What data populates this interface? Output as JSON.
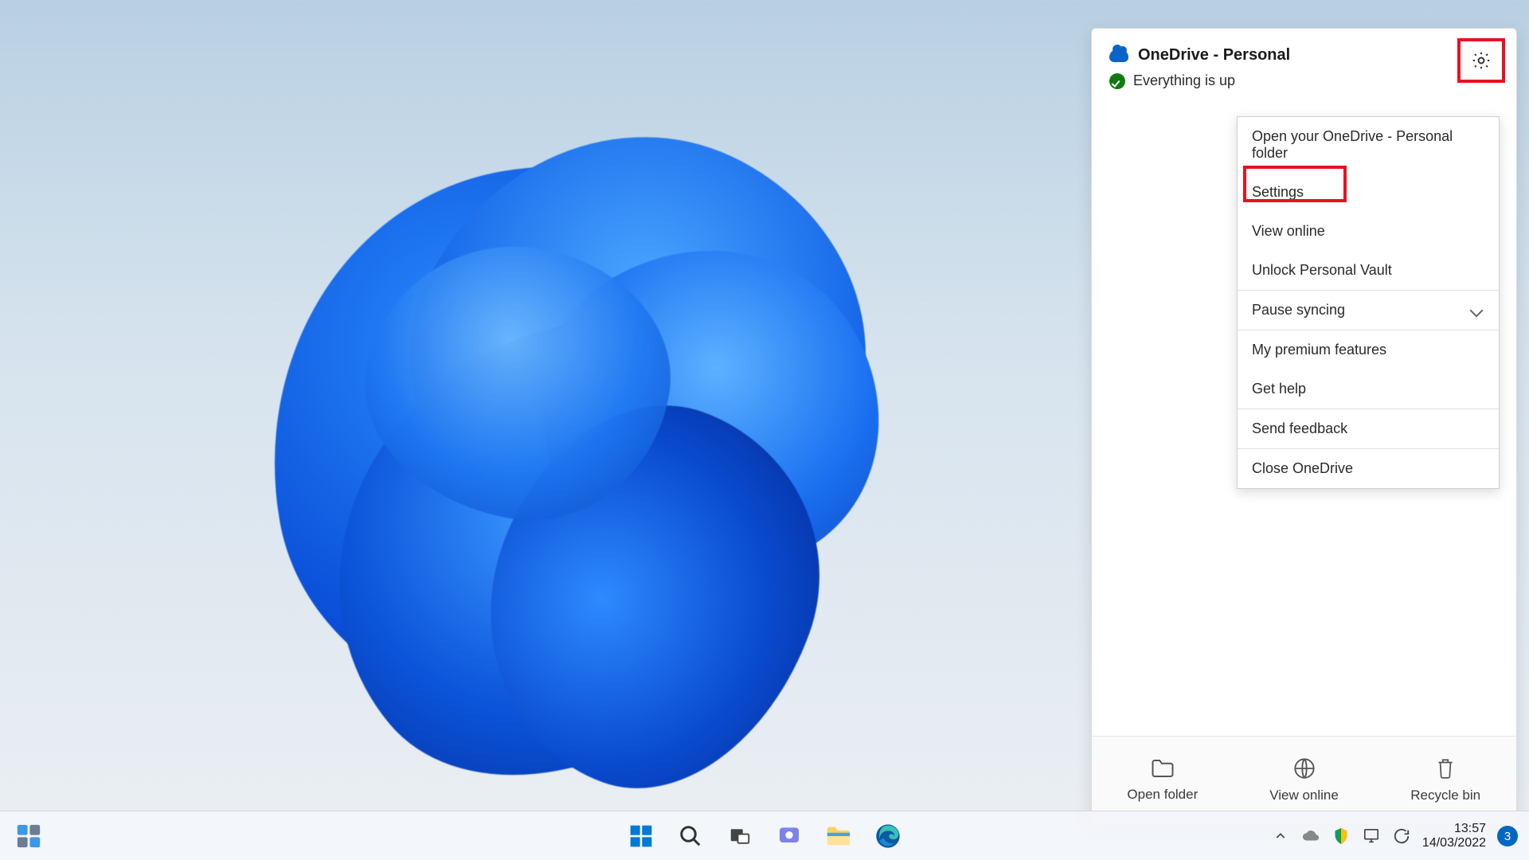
{
  "onedrive": {
    "title": "OneDrive - Personal",
    "status": "Everything is up",
    "menu": {
      "open_folder": "Open your OneDrive - Personal folder",
      "settings": "Settings",
      "view_online": "View online",
      "unlock_vault": "Unlock Personal Vault",
      "pause_syncing": "Pause syncing",
      "premium": "My premium features",
      "get_help": "Get help",
      "send_feedback": "Send feedback",
      "close": "Close OneDrive"
    },
    "footer": {
      "open_folder": "Open folder",
      "view_online": "View online",
      "recycle_bin": "Recycle bin"
    }
  },
  "taskbar": {
    "time": "13:57",
    "date": "14/03/2022",
    "notification_count": "3"
  },
  "icons": {
    "gear": "gear-icon",
    "cloud": "cloud-icon",
    "check": "check-icon",
    "chevron_down": "chevron-down-icon",
    "folder": "folder-icon",
    "globe": "globe-icon",
    "trash": "trash-icon",
    "start": "start-icon",
    "search": "search-icon",
    "taskview": "taskview-icon",
    "chat": "chat-icon",
    "explorer": "explorer-icon",
    "edge": "edge-icon",
    "widgets": "widgets-icon",
    "tray_chevron": "chevron-up-icon",
    "tray_onedrive": "onedrive-tray-icon",
    "tray_security": "security-icon",
    "tray_network": "network-icon",
    "tray_update": "update-icon"
  }
}
